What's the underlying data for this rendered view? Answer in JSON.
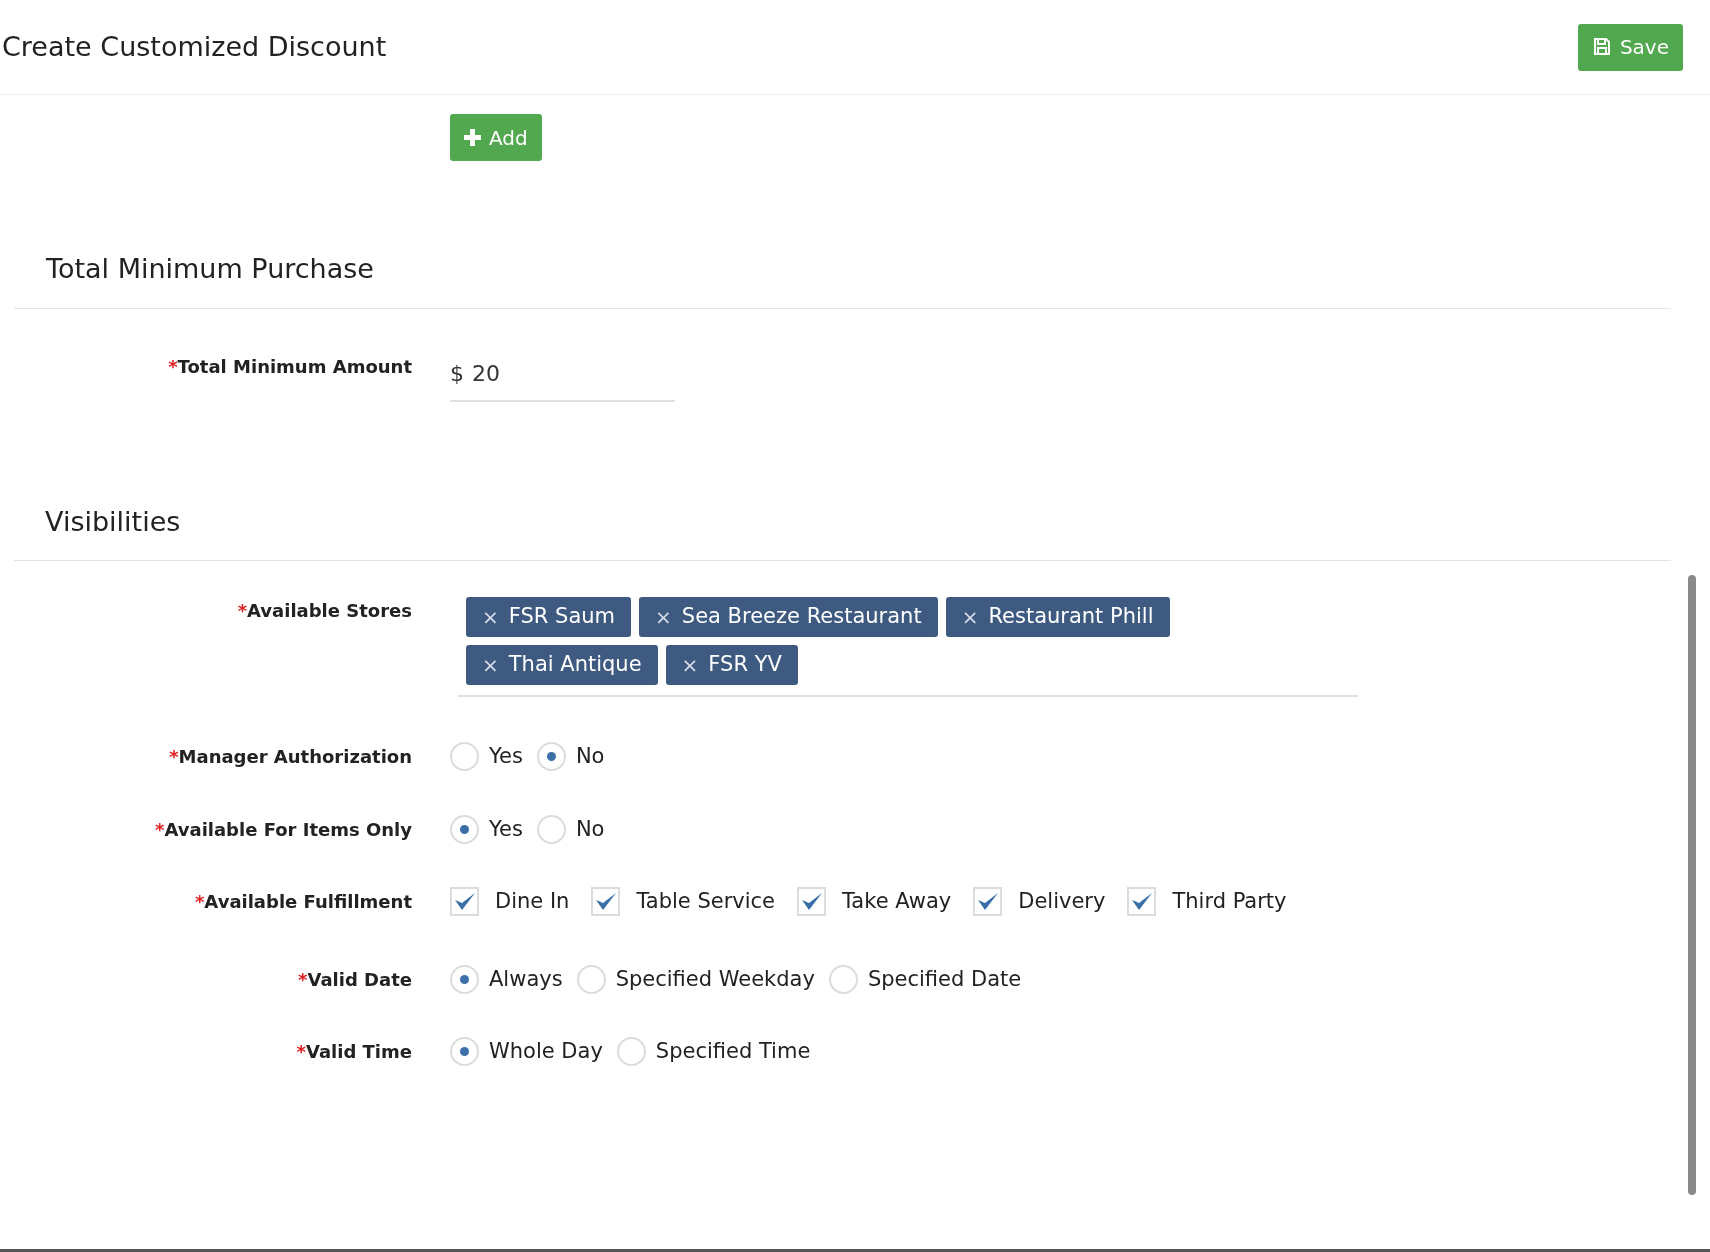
{
  "header": {
    "title": "Create Customized Discount",
    "save_button": "Save"
  },
  "add_button": "Add",
  "minimum_purchase": {
    "title": "Total Minimum Purchase",
    "field": {
      "required_mark": "*",
      "label": "Total Minimum Amount",
      "prefix": "$",
      "value": "20"
    }
  },
  "visibilities": {
    "title": "Visibilities",
    "fields": [
      {
        "kind": "tags",
        "required_mark": "*",
        "label": "Available Stores",
        "remove_mark": "×",
        "tags": [
          "FSR Saum",
          "Sea Breeze Restaurant",
          "Restaurant Phill",
          "Thai Antique",
          "FSR YV"
        ]
      },
      {
        "kind": "radio",
        "required_mark": "*",
        "label": "Manager Authorization",
        "options": [
          {
            "label": "Yes",
            "selected": false
          },
          {
            "label": "No",
            "selected": true
          }
        ]
      },
      {
        "kind": "radio",
        "required_mark": "*",
        "label": "Available For Items Only",
        "options": [
          {
            "label": "Yes",
            "selected": true
          },
          {
            "label": "No",
            "selected": false
          }
        ]
      },
      {
        "kind": "checkbox",
        "required_mark": "*",
        "label": "Available Fulfillment",
        "options": [
          {
            "label": "Dine In",
            "checked": true
          },
          {
            "label": "Table Service",
            "checked": true
          },
          {
            "label": "Take Away",
            "checked": true
          },
          {
            "label": "Delivery",
            "checked": true
          },
          {
            "label": "Third Party",
            "checked": true
          }
        ]
      },
      {
        "kind": "radio",
        "required_mark": "*",
        "label": "Valid Date",
        "options": [
          {
            "label": "Always",
            "selected": true
          },
          {
            "label": "Specified Weekday",
            "selected": false
          },
          {
            "label": "Specified Date",
            "selected": false
          }
        ]
      },
      {
        "kind": "radio",
        "required_mark": "*",
        "label": "Valid Time",
        "options": [
          {
            "label": "Whole Day",
            "selected": true
          },
          {
            "label": "Specified Time",
            "selected": false
          }
        ]
      }
    ]
  }
}
